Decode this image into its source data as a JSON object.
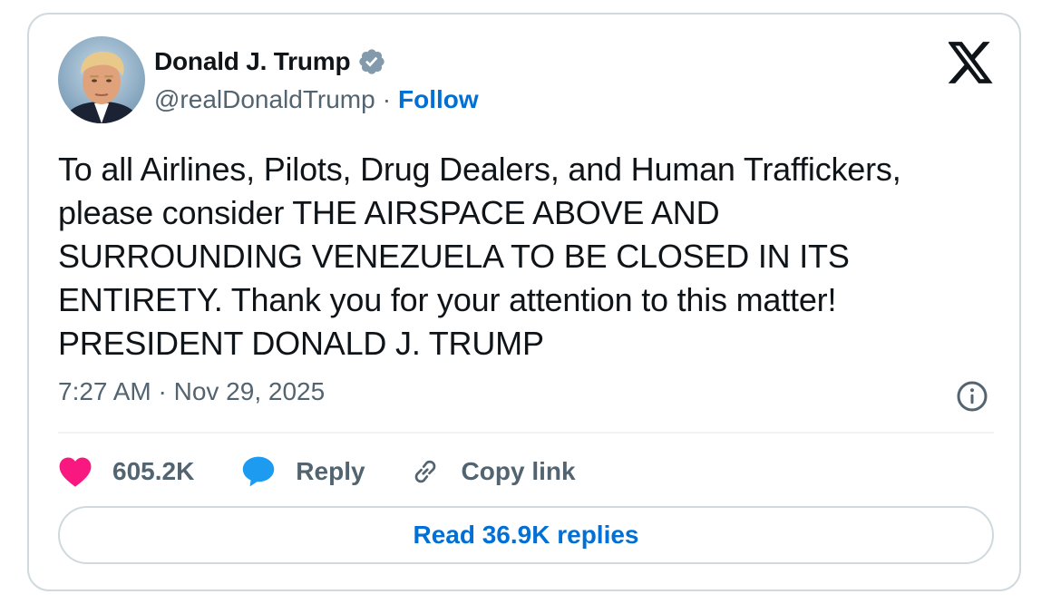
{
  "author": {
    "name": "Donald J. Trump",
    "handle": "@realDonaldTrump",
    "separator": "·",
    "follow_label": "Follow",
    "verified": true,
    "verified_color": "#829aab"
  },
  "tweet": {
    "text": "To all Airlines, Pilots, Drug Dealers, and Human Traffickers,\nplease consider THE AIRSPACE ABOVE AND\nSURROUNDING VENEZUELA TO BE CLOSED IN ITS\nENTIRETY. Thank you for your attention to this matter!\nPRESIDENT DONALD J. TRUMP",
    "timestamp": "7:27 AM · Nov 29, 2025"
  },
  "actions": {
    "like_count": "605.2K",
    "reply_label": "Reply",
    "copy_link_label": "Copy link"
  },
  "read_replies_label": "Read 36.9K replies",
  "icons": {
    "brand": "x-logo-icon",
    "verified": "verified-badge-icon",
    "info": "info-icon",
    "like": "heart-icon",
    "reply": "reply-bubble-icon",
    "copy_link": "link-icon"
  },
  "colors": {
    "text_primary": "#0f1419",
    "text_secondary": "#536471",
    "link_blue": "#006fd6",
    "heart_pink": "#f91880",
    "reply_blue": "#1d9bf0",
    "border": "#cfd9de"
  }
}
